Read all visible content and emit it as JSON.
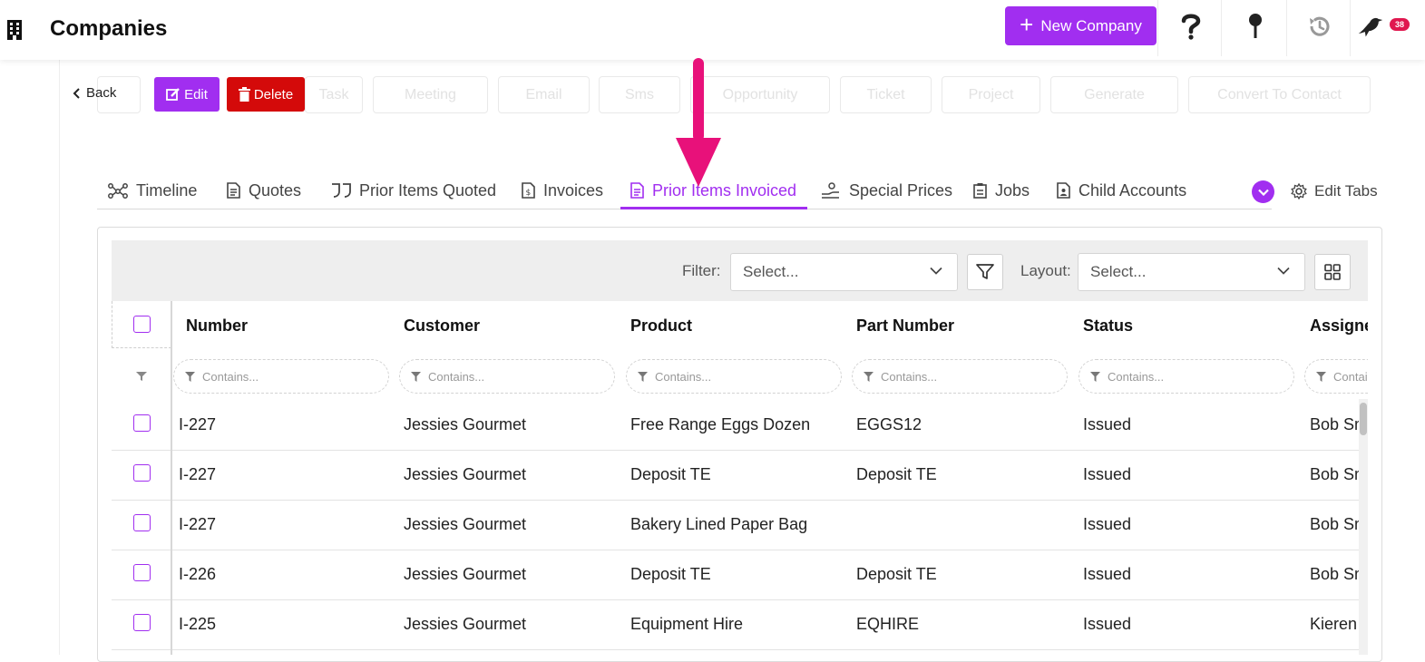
{
  "header": {
    "title": "Companies",
    "new_company_label": "New Company",
    "notification_count": "38"
  },
  "actions": {
    "back_label": "Back",
    "edit_label": "Edit",
    "delete_label": "Delete",
    "background_buttons": [
      "Task",
      "Meeting",
      "Email",
      "Sms",
      "Opportunity",
      "Ticket",
      "Project",
      "Generate",
      "Convert To Contact"
    ]
  },
  "tabs": [
    {
      "label": "Timeline",
      "icon": "timeline-icon"
    },
    {
      "label": "Quotes",
      "icon": "document-icon"
    },
    {
      "label": "Prior Items Quoted",
      "icon": "quote-marks-icon"
    },
    {
      "label": "Invoices",
      "icon": "invoice-icon"
    },
    {
      "label": "Prior Items Invoiced",
      "icon": "document-icon",
      "active": true
    },
    {
      "label": "Special Prices",
      "icon": "hand-coins-icon"
    },
    {
      "label": "Jobs",
      "icon": "clipboard-icon"
    },
    {
      "label": "Child Accounts",
      "icon": "contact-card-icon"
    }
  ],
  "edit_tabs_label": "Edit Tabs",
  "toolbar": {
    "filter_label": "Filter:",
    "filter_placeholder": "Select...",
    "layout_label": "Layout:",
    "layout_placeholder": "Select..."
  },
  "grid": {
    "columns": [
      "Number",
      "Customer",
      "Product",
      "Part Number",
      "Status",
      "Assigned"
    ],
    "filter_placeholder": "Contains...",
    "rows": [
      {
        "number": "I-227",
        "customer": "Jessies Gourmet",
        "product": "Free Range Eggs Dozen",
        "part_number": "EGGS12",
        "status": "Issued",
        "assigned": "Bob Smith"
      },
      {
        "number": "I-227",
        "customer": "Jessies Gourmet",
        "product": "Deposit TE",
        "part_number": "Deposit TE",
        "status": "Issued",
        "assigned": "Bob Smith"
      },
      {
        "number": "I-227",
        "customer": "Jessies Gourmet",
        "product": "Bakery Lined Paper Bag",
        "part_number": "",
        "status": "Issued",
        "assigned": "Bob Smith"
      },
      {
        "number": "I-226",
        "customer": "Jessies Gourmet",
        "product": "Deposit TE",
        "part_number": "Deposit TE",
        "status": "Issued",
        "assigned": "Bob Smith"
      },
      {
        "number": "I-225",
        "customer": "Jessies Gourmet",
        "product": "Equipment Hire",
        "part_number": "EQHIRE",
        "status": "Issued",
        "assigned": "Kieren"
      }
    ]
  },
  "colors": {
    "accent": "#a12ef0",
    "danger": "#d40a0a",
    "annotation_arrow": "#e8117a",
    "badge": "#e0174f"
  }
}
